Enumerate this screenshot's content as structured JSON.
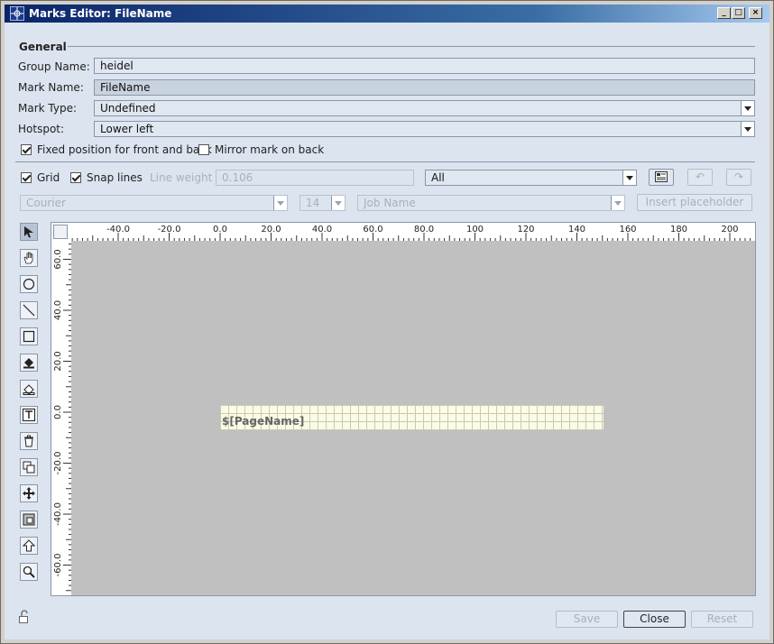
{
  "window": {
    "title": "Marks Editor: FileName"
  },
  "general": {
    "section_label": "General",
    "group_name_label": "Group Name:",
    "group_name_value": "heidel",
    "mark_name_label": "Mark Name:",
    "mark_name_value": "FileName",
    "mark_type_label": "Mark Type:",
    "mark_type_value": "Undefined",
    "hotspot_label": "Hotspot:",
    "hotspot_value": "Lower left",
    "fixed_position_label": "Fixed position for front and back",
    "fixed_position_checked": true,
    "mirror_label": "Mirror mark on back",
    "mirror_checked": false
  },
  "options": {
    "grid_label": "Grid",
    "grid_checked": true,
    "snap_label": "Snap lines",
    "snap_checked": true,
    "line_weight_label": "Line weight",
    "line_weight_value": "0.106",
    "layer_value": "All"
  },
  "text_options": {
    "font_value": "Courier",
    "size_value": "14",
    "placeholder_value": "Job Name",
    "insert_placeholder_label": "Insert placeholder"
  },
  "tools": [
    "select-arrow-icon",
    "hand-icon",
    "circle-icon",
    "line-icon",
    "rectangle-icon",
    "fill-icon",
    "image-icon",
    "text-icon",
    "trash-icon",
    "duplicate-icon",
    "move-icon",
    "resize-icon",
    "bring-front-icon",
    "zoom-icon"
  ],
  "ruler": {
    "top_labels": [
      "-40.0",
      "-20.0",
      "0.0",
      "20.0",
      "40.0",
      "60.0",
      "80.0",
      "100",
      "120",
      "140",
      "160",
      "180",
      "200"
    ],
    "left_labels": [
      "60.0",
      "40.0",
      "20.0",
      "0.0",
      "-20.0",
      "-40.0",
      "-60.0"
    ]
  },
  "canvas": {
    "mark_text": "$[PageName]"
  },
  "footer": {
    "save_label": "Save",
    "close_label": "Close",
    "reset_label": "Reset"
  },
  "colors": {
    "title_bar": "#0a246a",
    "panel": "#dbe4ef",
    "canvas": "#c0c0c0",
    "mark_box": "#fbfbe6"
  }
}
